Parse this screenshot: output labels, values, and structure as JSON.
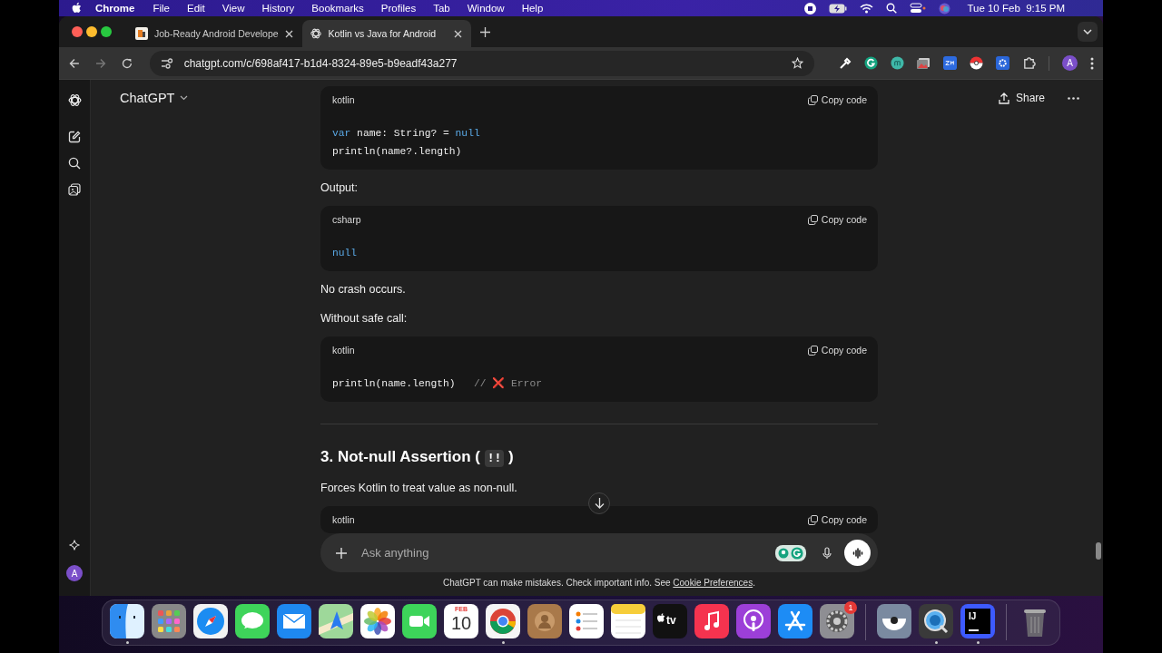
{
  "menubar": {
    "app": "Chrome",
    "menus": [
      "File",
      "Edit",
      "View",
      "History",
      "Bookmarks",
      "Profiles",
      "Tab",
      "Window",
      "Help"
    ],
    "clock": "Tue 10 Feb  9:15 PM"
  },
  "tabs": [
    {
      "title": "Job-Ready Android Develope",
      "selected": false
    },
    {
      "title": "Kotlin vs Java for Android",
      "selected": true
    }
  ],
  "address_bar": {
    "url": "chatgpt.com/c/698af417-b1d4-8324-89e5-b9eadf43a277"
  },
  "profile_initial": "A",
  "chat_header": {
    "title": "ChatGPT",
    "share": "Share"
  },
  "content": [
    {
      "kind": "code",
      "language": "kotlin",
      "copy": "Copy code",
      "lines": [
        [
          {
            "text": "var",
            "kind": "keyword"
          },
          {
            "text": " name: String? = ",
            "kind": "plain"
          },
          {
            "text": "null",
            "kind": "keyword"
          }
        ],
        [
          {
            "text": "println(name?.length)",
            "kind": "plain"
          }
        ]
      ]
    },
    {
      "kind": "paragraph",
      "text": "Output:"
    },
    {
      "kind": "code",
      "language": "csharp",
      "copy": "Copy code",
      "lines": [
        [
          {
            "text": "null",
            "kind": "keyword"
          }
        ]
      ]
    },
    {
      "kind": "paragraph",
      "text": "No crash occurs."
    },
    {
      "kind": "paragraph",
      "text": "Without safe call:"
    },
    {
      "kind": "code",
      "language": "kotlin",
      "copy": "Copy code",
      "lines": [
        [
          {
            "text": "println(name.length)",
            "kind": "plain"
          },
          {
            "text": "   // ",
            "kind": "comment"
          },
          {
            "text": "❌",
            "kind": "error"
          },
          {
            "text": " Error",
            "kind": "comment"
          }
        ]
      ]
    },
    {
      "kind": "divider"
    },
    {
      "kind": "heading",
      "parts": [
        {
          "text": "3. Not-null Assertion ( ",
          "code": false
        },
        {
          "text": "!!",
          "code": true
        },
        {
          "text": " )",
          "code": false
        }
      ]
    },
    {
      "kind": "paragraph",
      "text": "Forces Kotlin to treat value as non-null."
    },
    {
      "kind": "code",
      "language": "kotlin",
      "copy": "Copy code"
    }
  ],
  "composer": {
    "placeholder": "Ask anything"
  },
  "disclaimer": {
    "text": "ChatGPT can make mistakes. Check important info. See ",
    "link": "Cookie Preferences",
    "end": "."
  },
  "sidebar": {
    "avatar": "A"
  },
  "dock": [
    {
      "kind": "finder",
      "running": true
    },
    {
      "kind": "launchpad",
      "running": false
    },
    {
      "kind": "safari",
      "running": false
    },
    {
      "kind": "messages",
      "running": false
    },
    {
      "kind": "mail",
      "running": false
    },
    {
      "kind": "maps",
      "running": false
    },
    {
      "kind": "photos",
      "running": false
    },
    {
      "kind": "facetime",
      "running": false
    },
    {
      "kind": "calendar",
      "running": false,
      "month": "FEB",
      "day": "10"
    },
    {
      "kind": "chrome",
      "running": true
    },
    {
      "kind": "contacts",
      "running": false
    },
    {
      "kind": "reminders",
      "running": false
    },
    {
      "kind": "notes",
      "running": false
    },
    {
      "kind": "tv",
      "running": false,
      "label": "tv"
    },
    {
      "kind": "music",
      "running": false
    },
    {
      "kind": "podcasts",
      "running": false
    },
    {
      "kind": "appstore",
      "running": false
    },
    {
      "kind": "settings",
      "running": false,
      "badge": "1"
    },
    {
      "kind": "separator"
    },
    {
      "kind": "eye",
      "running": false
    },
    {
      "kind": "quicktime",
      "running": true
    },
    {
      "kind": "ide",
      "running": true,
      "label": "IJ"
    },
    {
      "kind": "separator"
    },
    {
      "kind": "trash",
      "running": false
    }
  ]
}
